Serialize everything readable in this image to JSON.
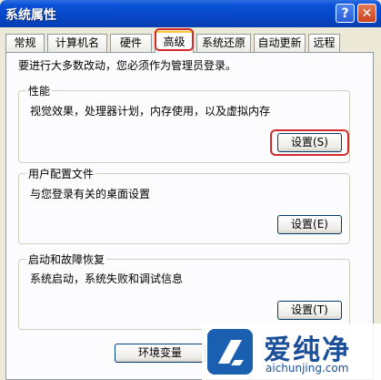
{
  "window": {
    "title": "系统属性",
    "help_glyph": "?",
    "close_glyph": "✕"
  },
  "tabs": [
    {
      "label": "常规",
      "active": false
    },
    {
      "label": "计算机名",
      "active": false
    },
    {
      "label": "硬件",
      "active": false
    },
    {
      "label": "高级",
      "active": true
    },
    {
      "label": "系统还原",
      "active": false
    },
    {
      "label": "自动更新",
      "active": false
    },
    {
      "label": "远程",
      "active": false
    }
  ],
  "admin_note": "要进行大多数改动，您必须作为管理员登录。",
  "groups": {
    "performance": {
      "title": "性能",
      "description": "视觉效果，处理器计划，内存使用，以及虚拟内存",
      "button_label": "设置(S)"
    },
    "user_profiles": {
      "title": "用户配置文件",
      "description": "与您登录有关的桌面设置",
      "button_label": "设置(E)"
    },
    "startup_recovery": {
      "title": "启动和故障恢复",
      "description": "系统启动，系统失败和调试信息",
      "button_label": "设置(T)"
    }
  },
  "env_button_label": "环境变量",
  "watermark": {
    "text": "爱纯净",
    "url": "aichunjing.com"
  },
  "colors": {
    "titlebar": "#0546c7",
    "dialog_bg": "#ece9d8",
    "panel_bg": "#fcfcfe",
    "highlight": "#d32b2b"
  }
}
